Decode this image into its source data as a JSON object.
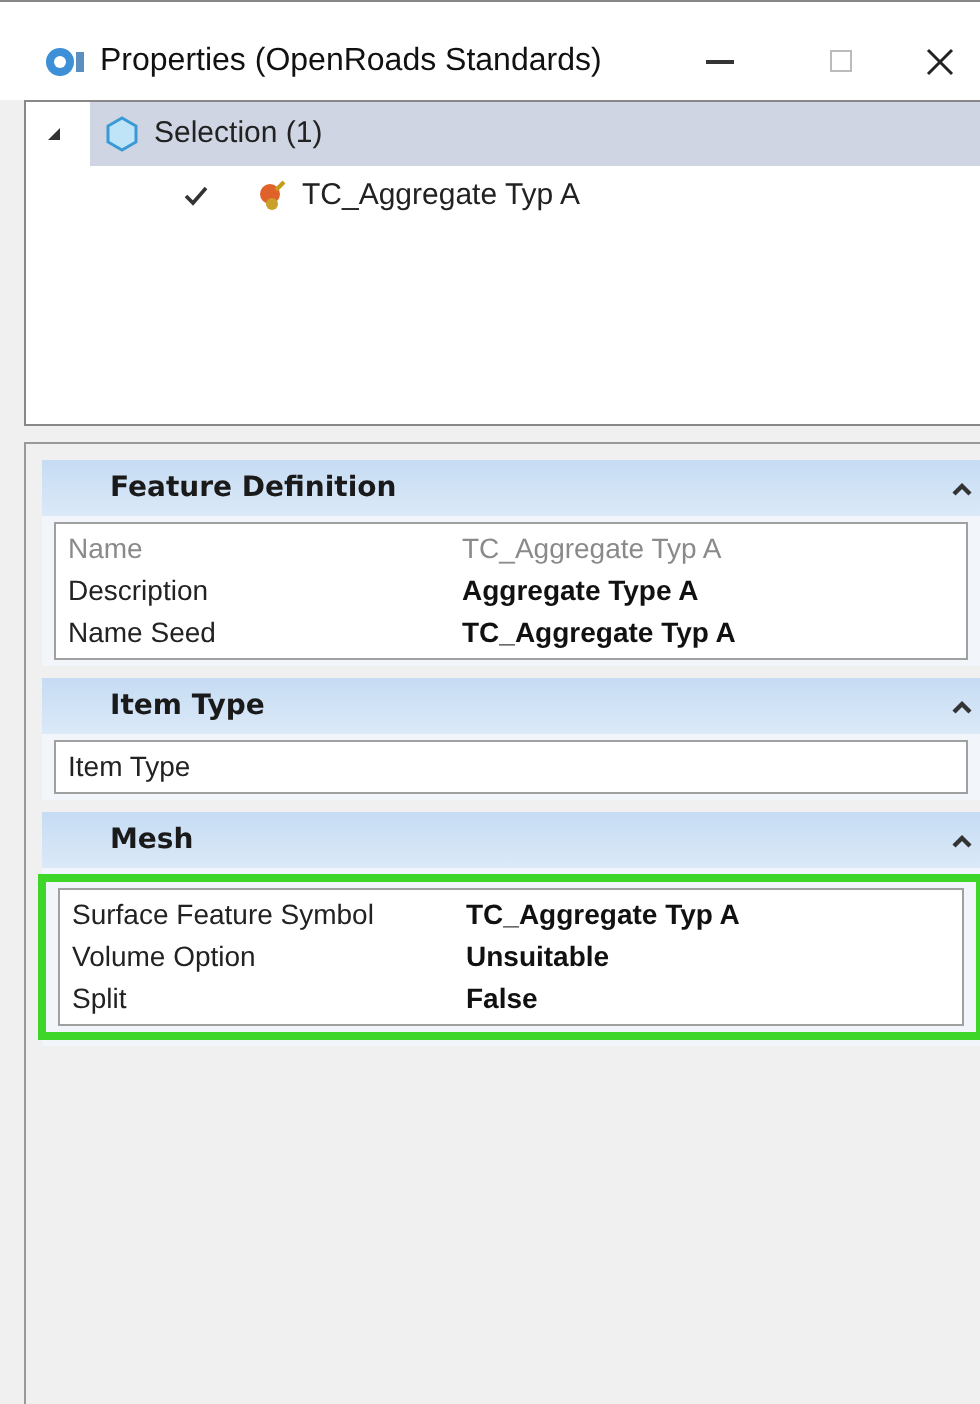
{
  "window": {
    "title": "Properties (OpenRoads Standards)"
  },
  "tree": [
    {
      "label": "Selection (1)",
      "expanded": true,
      "selected": true,
      "children": [
        {
          "label": "TC_Aggregate Typ A",
          "checked": true
        }
      ]
    }
  ],
  "sections": [
    {
      "title": "Feature Definition",
      "expanded": true,
      "highlighted": false,
      "rows": [
        {
          "label": "Name",
          "value": "TC_Aggregate Typ A",
          "disabled": true
        },
        {
          "label": "Description",
          "value": "Aggregate Type A",
          "disabled": false
        },
        {
          "label": "Name Seed",
          "value": "TC_Aggregate Typ A",
          "disabled": false
        }
      ]
    },
    {
      "title": "Item Type",
      "expanded": true,
      "highlighted": false,
      "rows": [
        {
          "label": "Item Type",
          "disabled": false
        }
      ]
    },
    {
      "title": "Mesh",
      "expanded": true,
      "highlighted": true,
      "rows": [
        {
          "label": "Surface Feature Symbol",
          "value": "TC_Aggregate Typ A",
          "disabled": false
        },
        {
          "label": "Volume Option",
          "value": "Unsuitable",
          "disabled": false
        },
        {
          "label": "Split",
          "value": "False",
          "disabled": false
        }
      ]
    }
  ]
}
